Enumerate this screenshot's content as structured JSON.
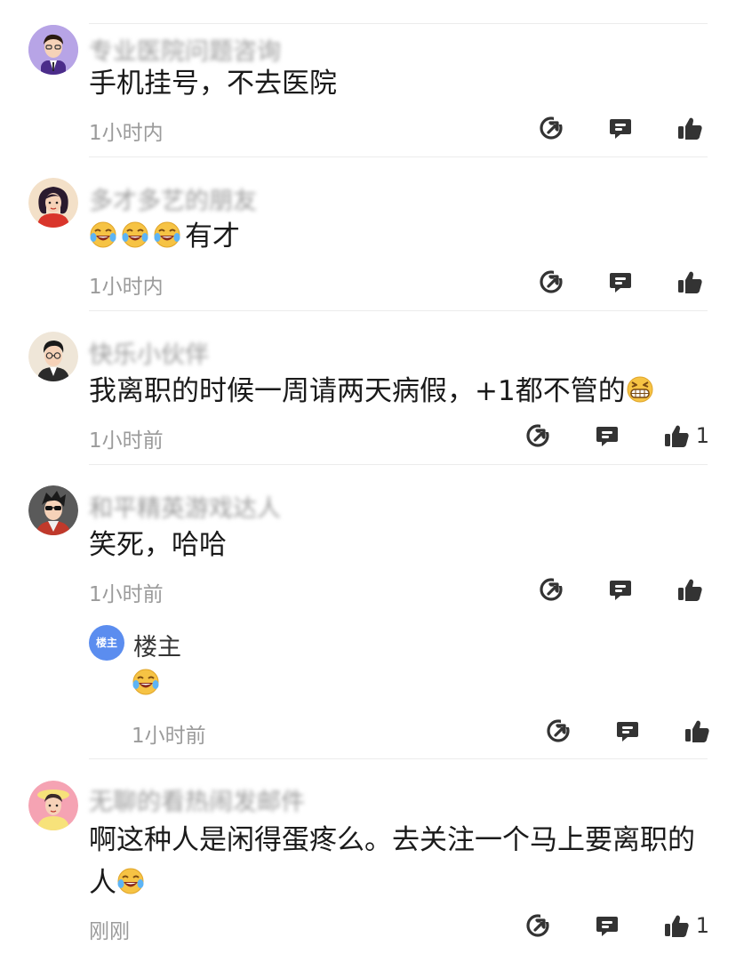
{
  "comments": [
    {
      "username": "专业医院问题咨询",
      "text": "手机挂号，不去医院",
      "time": "1小时内",
      "likes": ""
    },
    {
      "username": "多才多艺的朋友",
      "text_after_emoji": "有才",
      "time": "1小时内",
      "likes": ""
    },
    {
      "username": "快乐小伙伴",
      "text_before_emoji": "我离职的时候一周请两天病假，+1都不管的",
      "time": "1小时前",
      "likes": "1"
    },
    {
      "username": "和平精英游戏达人",
      "text": "笑死，哈哈",
      "time": "1小时前",
      "likes": "",
      "reply": {
        "badge": "楼主",
        "name": "楼主",
        "time": "1小时前"
      }
    },
    {
      "username": "无聊的看热闹发邮件",
      "text_before_emoji": "啊这种人是闲得蛋疼么。去关注一个马上要离职的人",
      "time": "刚刚",
      "likes": "1"
    }
  ],
  "icons": {
    "share": "share-icon",
    "reply": "comment-icon",
    "like": "thumbs-up-icon"
  }
}
